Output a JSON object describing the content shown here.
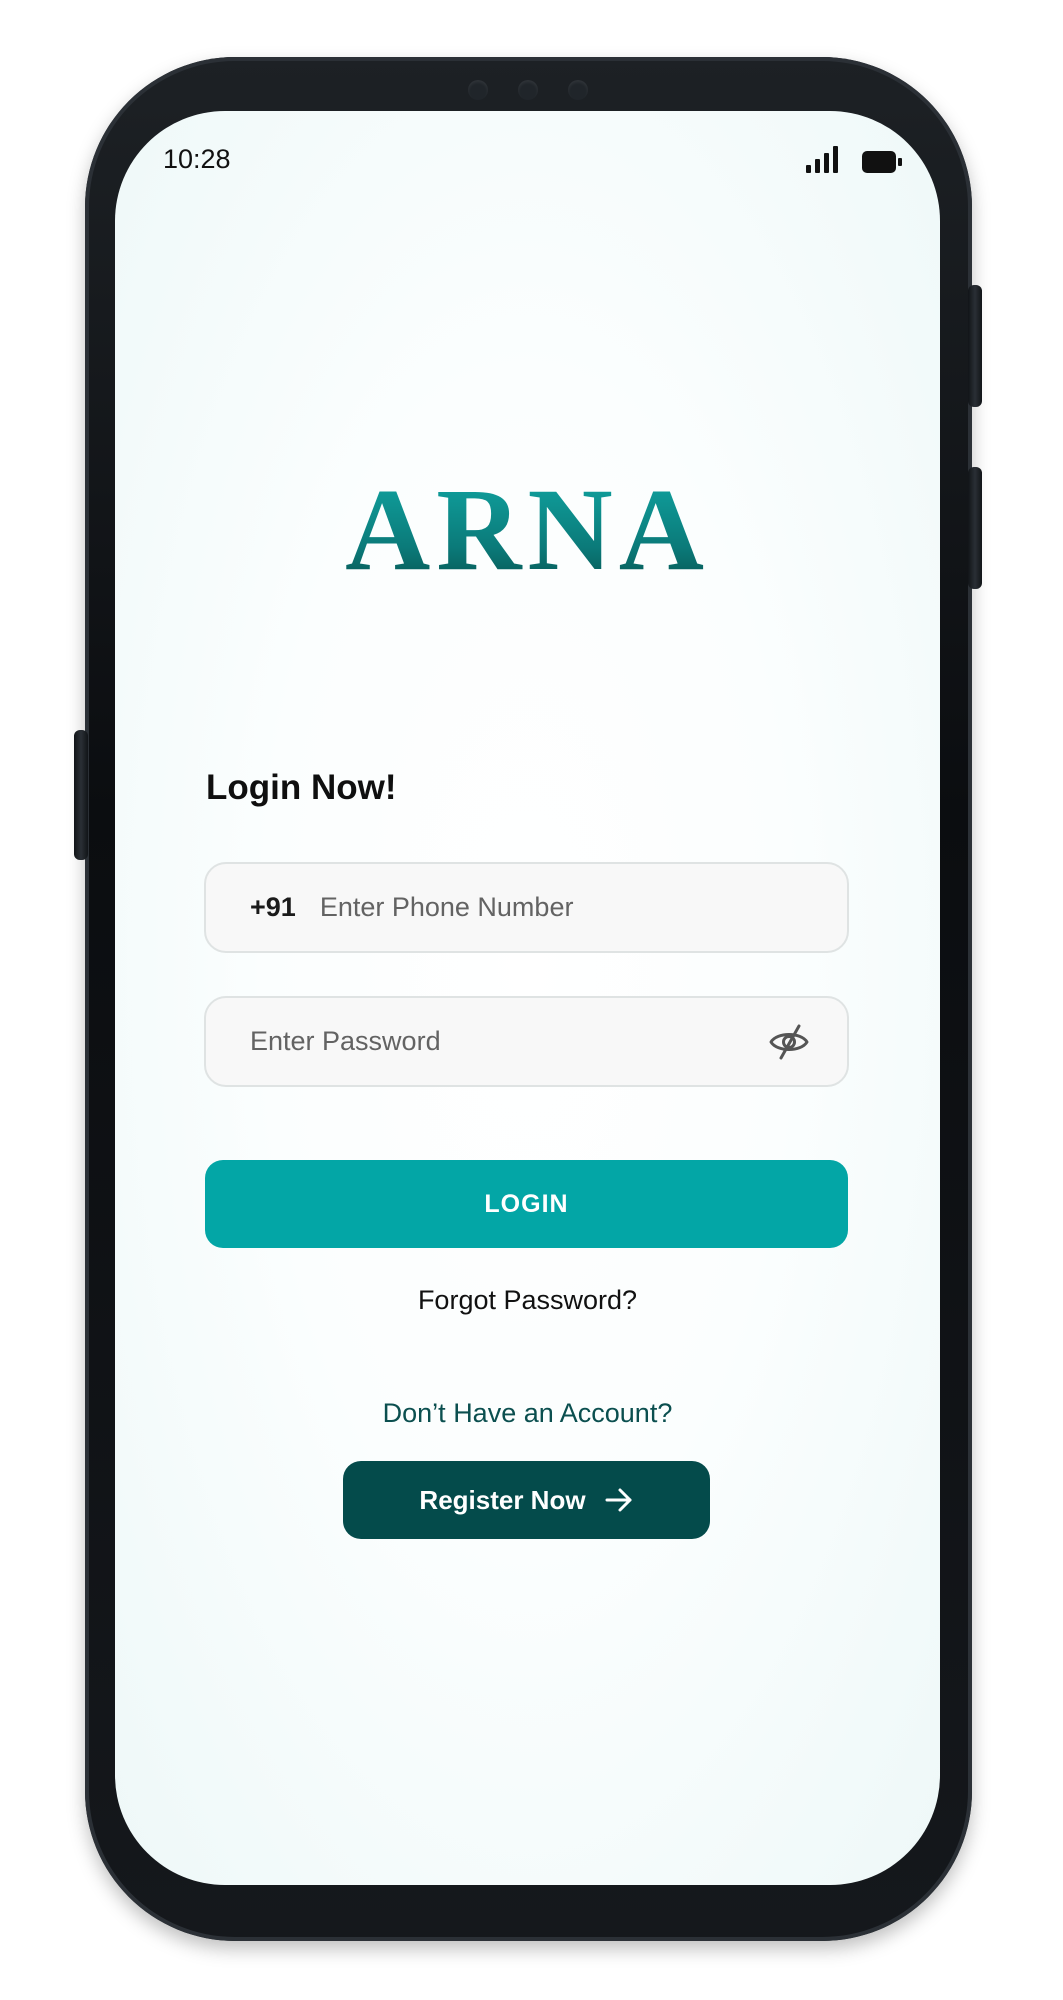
{
  "status_bar": {
    "time": "10:28",
    "signal_icon": "signal-bars-icon",
    "battery_icon": "battery-icon"
  },
  "brand": {
    "logo_text": "ARNA",
    "logo_colors": [
      "#10a5a2",
      "#06534f"
    ]
  },
  "login_form": {
    "title": "Login Now!",
    "phone": {
      "country_code": "+91",
      "placeholder": "Enter Phone Number",
      "value": ""
    },
    "password": {
      "placeholder": "Enter Password",
      "value": "",
      "visibility_icon": "eye-off-icon"
    },
    "login_button_label": "LOGIN",
    "forgot_password_label": "Forgot Password?"
  },
  "register": {
    "prompt": "Don’t Have an Account?",
    "button_label": "Register Now",
    "button_icon": "arrow-right-icon"
  },
  "colors": {
    "primary": "#03a6a6",
    "dark_teal": "#044b4b",
    "text": "#0f0f0f"
  }
}
